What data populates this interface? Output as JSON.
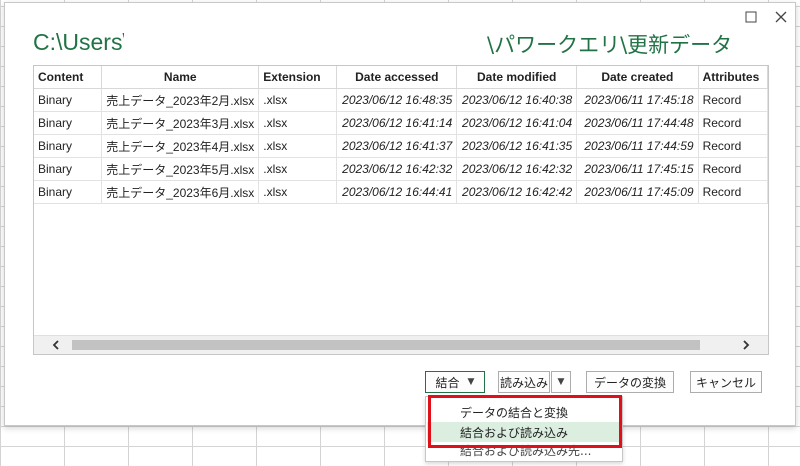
{
  "title_path_prefix": "C:\\Users\\",
  "title_path_suffix": "\\パワークエリ\\更新データ",
  "columns": [
    "Content",
    "Name",
    "Extension",
    "Date accessed",
    "Date modified",
    "Date created",
    "Attributes"
  ],
  "rows": [
    {
      "content": "Binary",
      "name": "売上データ_2023年2月.xlsx",
      "extension": ".xlsx",
      "accessed": "2023/06/12 16:48:35",
      "modified": "2023/06/12 16:40:38",
      "created": "2023/06/11 17:45:18",
      "attributes": "Record"
    },
    {
      "content": "Binary",
      "name": "売上データ_2023年3月.xlsx",
      "extension": ".xlsx",
      "accessed": "2023/06/12 16:41:14",
      "modified": "2023/06/12 16:41:04",
      "created": "2023/06/11 17:44:48",
      "attributes": "Record"
    },
    {
      "content": "Binary",
      "name": "売上データ_2023年4月.xlsx",
      "extension": ".xlsx",
      "accessed": "2023/06/12 16:41:37",
      "modified": "2023/06/12 16:41:35",
      "created": "2023/06/11 17:44:59",
      "attributes": "Record"
    },
    {
      "content": "Binary",
      "name": "売上データ_2023年5月.xlsx",
      "extension": ".xlsx",
      "accessed": "2023/06/12 16:42:32",
      "modified": "2023/06/12 16:42:32",
      "created": "2023/06/11 17:45:15",
      "attributes": "Record"
    },
    {
      "content": "Binary",
      "name": "売上データ_2023年6月.xlsx",
      "extension": ".xlsx",
      "accessed": "2023/06/12 16:44:41",
      "modified": "2023/06/12 16:42:42",
      "created": "2023/06/11 17:45:09",
      "attributes": "Record"
    }
  ],
  "buttons": {
    "combine": "結合",
    "load": "読み込み",
    "transform": "データの変換",
    "cancel": "キャンセル"
  },
  "dropdown": {
    "items": [
      "データの結合と変換",
      "結合および読み込み",
      "結合および読み込み先..."
    ],
    "highlighted": "結合および読み込み"
  },
  "icons": {
    "maximize": "maximize-icon",
    "close": "close-icon",
    "scroll_left": "chevron-left-icon",
    "scroll_right": "chevron-right-icon",
    "dropdown": "caret-down-icon"
  },
  "colors": {
    "title": "#217346",
    "highlight_border": "#e0101a",
    "highlight_fill": "#dbeee0"
  }
}
